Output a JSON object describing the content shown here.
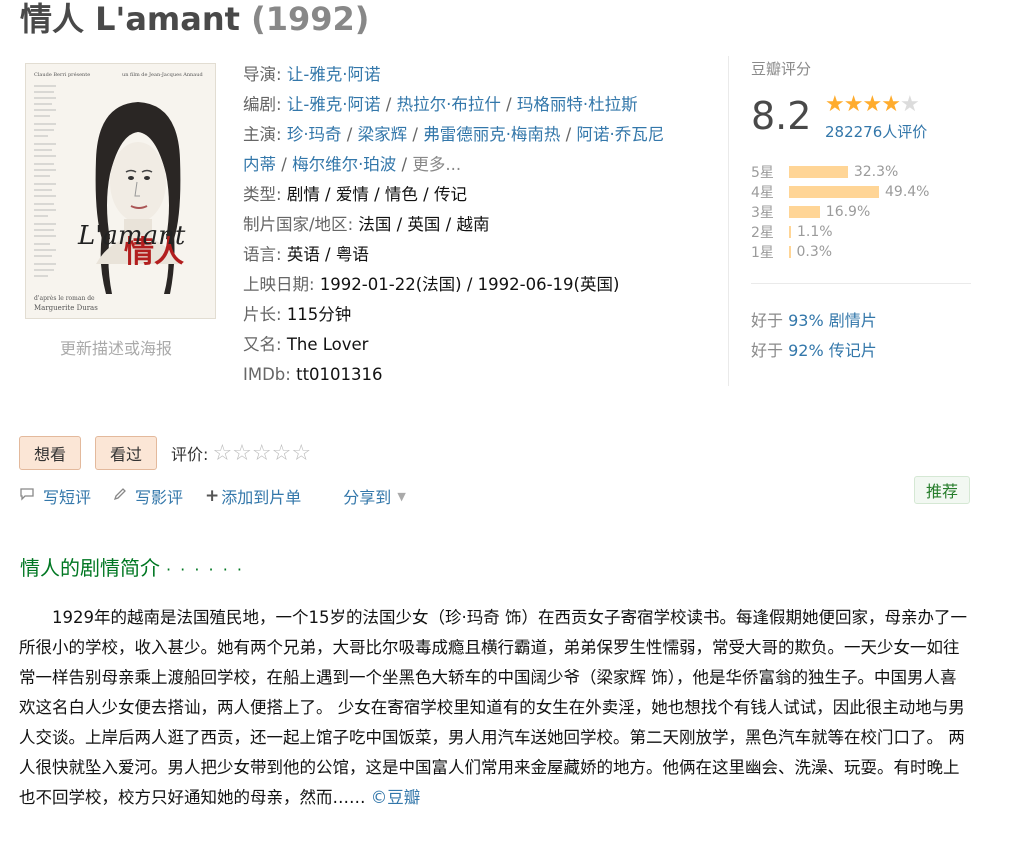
{
  "title": {
    "name": "情人 L'amant",
    "year": "(1992)"
  },
  "poster": {
    "credit_left": "Claude Berri présente",
    "credit_right": "un film de Jean-Jacques Annaud",
    "hanzi": "情人",
    "film_title": "L'amant",
    "footer_1": "d'après le roman de",
    "footer_2": "Marguerite Duras"
  },
  "update_link": "更新描述或海报",
  "info": {
    "director": {
      "label": "导演",
      "values": [
        "让-雅克·阿诺"
      ]
    },
    "writer": {
      "label": "编剧",
      "values": [
        "让-雅克·阿诺",
        "热拉尔·布拉什",
        "玛格丽特·杜拉斯"
      ]
    },
    "cast": {
      "label": "主演",
      "values": [
        "珍·玛奇",
        "梁家辉",
        "弗雷德丽克·梅南热",
        "阿诺·乔瓦尼",
        "内蒂",
        "梅尔维尔·珀波"
      ],
      "more": "更多..."
    },
    "genre": {
      "label": "类型",
      "value": "剧情 / 爱情 / 情色 / 传记"
    },
    "country": {
      "label": "制片国家/地区",
      "value": "法国 / 英国 / 越南"
    },
    "language": {
      "label": "语言",
      "value": "英语 / 粤语"
    },
    "release": {
      "label": "上映日期",
      "value": "1992-01-22(法国) / 1992-06-19(英国)"
    },
    "runtime": {
      "label": "片长",
      "value": "115分钟"
    },
    "aka": {
      "label": "又名",
      "value": "The Lover"
    },
    "imdb": {
      "label": "IMDb",
      "value": "tt0101316"
    }
  },
  "rating": {
    "title": "豆瓣评分",
    "score": "8.2",
    "stars": 4,
    "people": "282276人评价",
    "breakdown": [
      {
        "label": "5星",
        "pct": "32.3%",
        "value": 32.3
      },
      {
        "label": "4星",
        "pct": "49.4%",
        "value": 49.4
      },
      {
        "label": "3星",
        "pct": "16.9%",
        "value": 16.9
      },
      {
        "label": "2星",
        "pct": "1.1%",
        "value": 1.1
      },
      {
        "label": "1星",
        "pct": "0.3%",
        "value": 0.3
      }
    ],
    "better_than": [
      {
        "prefix": "好于",
        "value": "93% 剧情片"
      },
      {
        "prefix": "好于",
        "value": "92% 传记片"
      }
    ]
  },
  "actions": {
    "want": "想看",
    "seen": "看过",
    "rate_label": "评价:",
    "rate_stars": "☆☆☆☆☆"
  },
  "ops": {
    "short_review": "写短评",
    "review": "写影评",
    "add_list": "添加到片单",
    "share": "分享到",
    "recommend": "推荐"
  },
  "intro": {
    "heading": "情人的剧情简介",
    "dots": "· · · · · ·",
    "body": "1929年的越南是法国殖民地，一个15岁的法国少女（珍·玛奇 饰）在西贡女子寄宿学校读书。每逢假期她便回家，母亲办了一所很小的学校，收入甚少。她有两个兄弟，大哥比尔吸毒成瘾且横行霸道，弟弟保罗生性懦弱，常受大哥的欺负。一天少女一如往常一样告别母亲乘上渡船回学校，在船上遇到一个坐黑色大轿车的中国阔少爷（梁家辉 饰），他是华侨富翁的独生子。中国男人喜欢这名白人少女便去搭讪，两人便搭上了。 少女在寄宿学校里知道有的女生在外卖淫，她也想找个有钱人试试，因此很主动地与男人交谈。上岸后两人逛了西贡，还一起上馆子吃中国饭菜，男人用汽车送她回学校。第二天刚放学，黑色汽车就等在校门口了。 两人很快就坠入爱河。男人把少女带到他的公馆，这是中国富人们常用来金屋藏娇的地方。他俩在这里幽会、洗澡、玩耍。有时晚上也不回学校，校方只好通知她的母亲，然而……",
    "source": "©豆瓣"
  },
  "colors": {
    "link": "#3377aa",
    "star": "#ffac2d",
    "bar": "#ffd596",
    "heading_green": "#007722",
    "button_bg": "#fbe6d6"
  }
}
